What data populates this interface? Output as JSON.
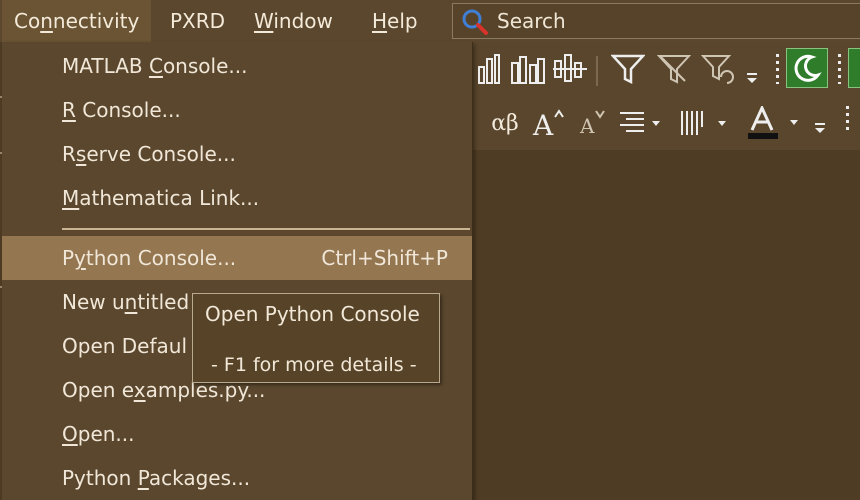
{
  "menubar": {
    "items": [
      "Connectivity",
      "PXRD",
      "Window",
      "Help"
    ]
  },
  "search": {
    "label": "Search",
    "icon": "magnifier-icon"
  },
  "toolbar": {
    "row1_icons": [
      "column-chart-icon",
      "grouped-column-chart-icon",
      "floating-column-icon",
      "filter-icon",
      "filter-off-icon",
      "filter-reapply-icon",
      "overflow-icon",
      "dark-mode-icon",
      "frame-icon"
    ],
    "row2_icons": [
      "greek-letters-icon",
      "increase-font-icon",
      "decrease-font-icon",
      "align-icon",
      "column-format-icon",
      "font-color-icon",
      "overflow-icon"
    ],
    "greek_text": "αβ"
  },
  "dropdown": {
    "items": [
      {
        "label": "MATLAB Console...",
        "shortcut": ""
      },
      {
        "label": "R Console...",
        "shortcut": ""
      },
      {
        "label": "Rserve Console...",
        "shortcut": ""
      },
      {
        "label": "Mathematica Link...",
        "shortcut": ""
      },
      {
        "label": "Python Console...",
        "shortcut": "Ctrl+Shift+P"
      },
      {
        "label": "New untitled",
        "shortcut": ""
      },
      {
        "label": "Open Defaul",
        "shortcut": ""
      },
      {
        "label": "Open examples.py...",
        "shortcut": ""
      },
      {
        "label": "Open...",
        "shortcut": ""
      },
      {
        "label": "Python Packages...",
        "shortcut": ""
      }
    ]
  },
  "tooltip": {
    "title": "Open Python Console",
    "hint": "- F1 for more details -"
  },
  "colors": {
    "background": "#4f3c24",
    "menu": "#5b472d",
    "highlight": "#947650",
    "accent_green": "#2f7d2a"
  }
}
